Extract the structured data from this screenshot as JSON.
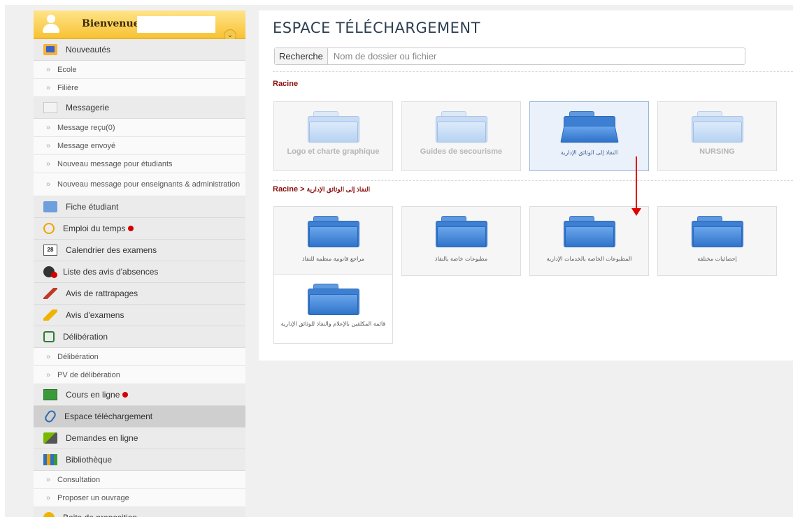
{
  "sidebar": {
    "welcome": "Bienvenue",
    "items": [
      {
        "type": "menu",
        "icon": "news-icon",
        "label": "Nouveautés"
      },
      {
        "type": "sub",
        "label": "Ecole"
      },
      {
        "type": "sub",
        "label": "Filière"
      },
      {
        "type": "menu",
        "icon": "envelope-icon",
        "label": "Messagerie"
      },
      {
        "type": "sub",
        "label": "Message reçu(0)"
      },
      {
        "type": "sub",
        "label": "Message envoyé"
      },
      {
        "type": "sub",
        "label": "Nouveau message pour étudiants"
      },
      {
        "type": "sub",
        "label": "Nouveau message pour enseignants & administration"
      },
      {
        "type": "menu",
        "icon": "student-card-icon",
        "label": "Fiche étudiant"
      },
      {
        "type": "menu",
        "icon": "clock-icon",
        "label": "Emploi du temps",
        "badge": true
      },
      {
        "type": "menu",
        "icon": "calendar-icon",
        "label": "Calendrier des examens",
        "icon_text": "28"
      },
      {
        "type": "menu",
        "icon": "absence-icon",
        "label": "Liste des avis d'absences"
      },
      {
        "type": "menu",
        "icon": "pencil-red-icon",
        "label": "Avis de rattrapages"
      },
      {
        "type": "menu",
        "icon": "pencil-yellow-icon",
        "label": "Avis d'examens"
      },
      {
        "type": "menu",
        "icon": "deliberation-icon",
        "label": "Délibération"
      },
      {
        "type": "sub",
        "label": "Délibération"
      },
      {
        "type": "sub",
        "label": "PV de délibération"
      },
      {
        "type": "menu",
        "icon": "abc-board-icon",
        "label": "Cours en ligne",
        "badge": true
      },
      {
        "type": "menu",
        "icon": "paperclip-icon",
        "label": "Espace téléchargement",
        "active": true
      },
      {
        "type": "menu",
        "icon": "tools-icon",
        "label": "Demandes en ligne"
      },
      {
        "type": "menu",
        "icon": "books-icon",
        "label": "Bibliothèque"
      },
      {
        "type": "sub",
        "label": "Consultation"
      },
      {
        "type": "sub",
        "label": "Proposer un ouvrage"
      },
      {
        "type": "menu",
        "icon": "lightbulb-icon",
        "label": "Boite de proposition"
      }
    ]
  },
  "main": {
    "title": "ESPACE TÉLÉCHARGEMENT",
    "search": {
      "label": "Recherche",
      "placeholder": "Nom de dossier ou fichier"
    },
    "root_label": "Racine",
    "root_folders": [
      {
        "label": "Logo et charte graphique"
      },
      {
        "label": "Guides de secourisme"
      },
      {
        "label": "النفاذ إلى الوثائق الإدارية",
        "selected": true
      },
      {
        "label": "NURSING"
      }
    ],
    "breadcrumb": {
      "root": "Racine",
      "separator": ">",
      "current": "النفاذ إلى الوثائق الإدارية"
    },
    "sub_folders": [
      {
        "label": "مراجع قانونية منظمة للنفاذ"
      },
      {
        "label": "مطبوعات خاصة بالنفاذ"
      },
      {
        "label": "المطبوعات الخاصة بالخدمات الإدارية"
      },
      {
        "label": "إحصائيات مختلفة"
      },
      {
        "label": "قائمة المكلفين بالإعلام والنفاذ للوثائق الإدارية"
      }
    ],
    "annotation_color": "#e00000"
  }
}
